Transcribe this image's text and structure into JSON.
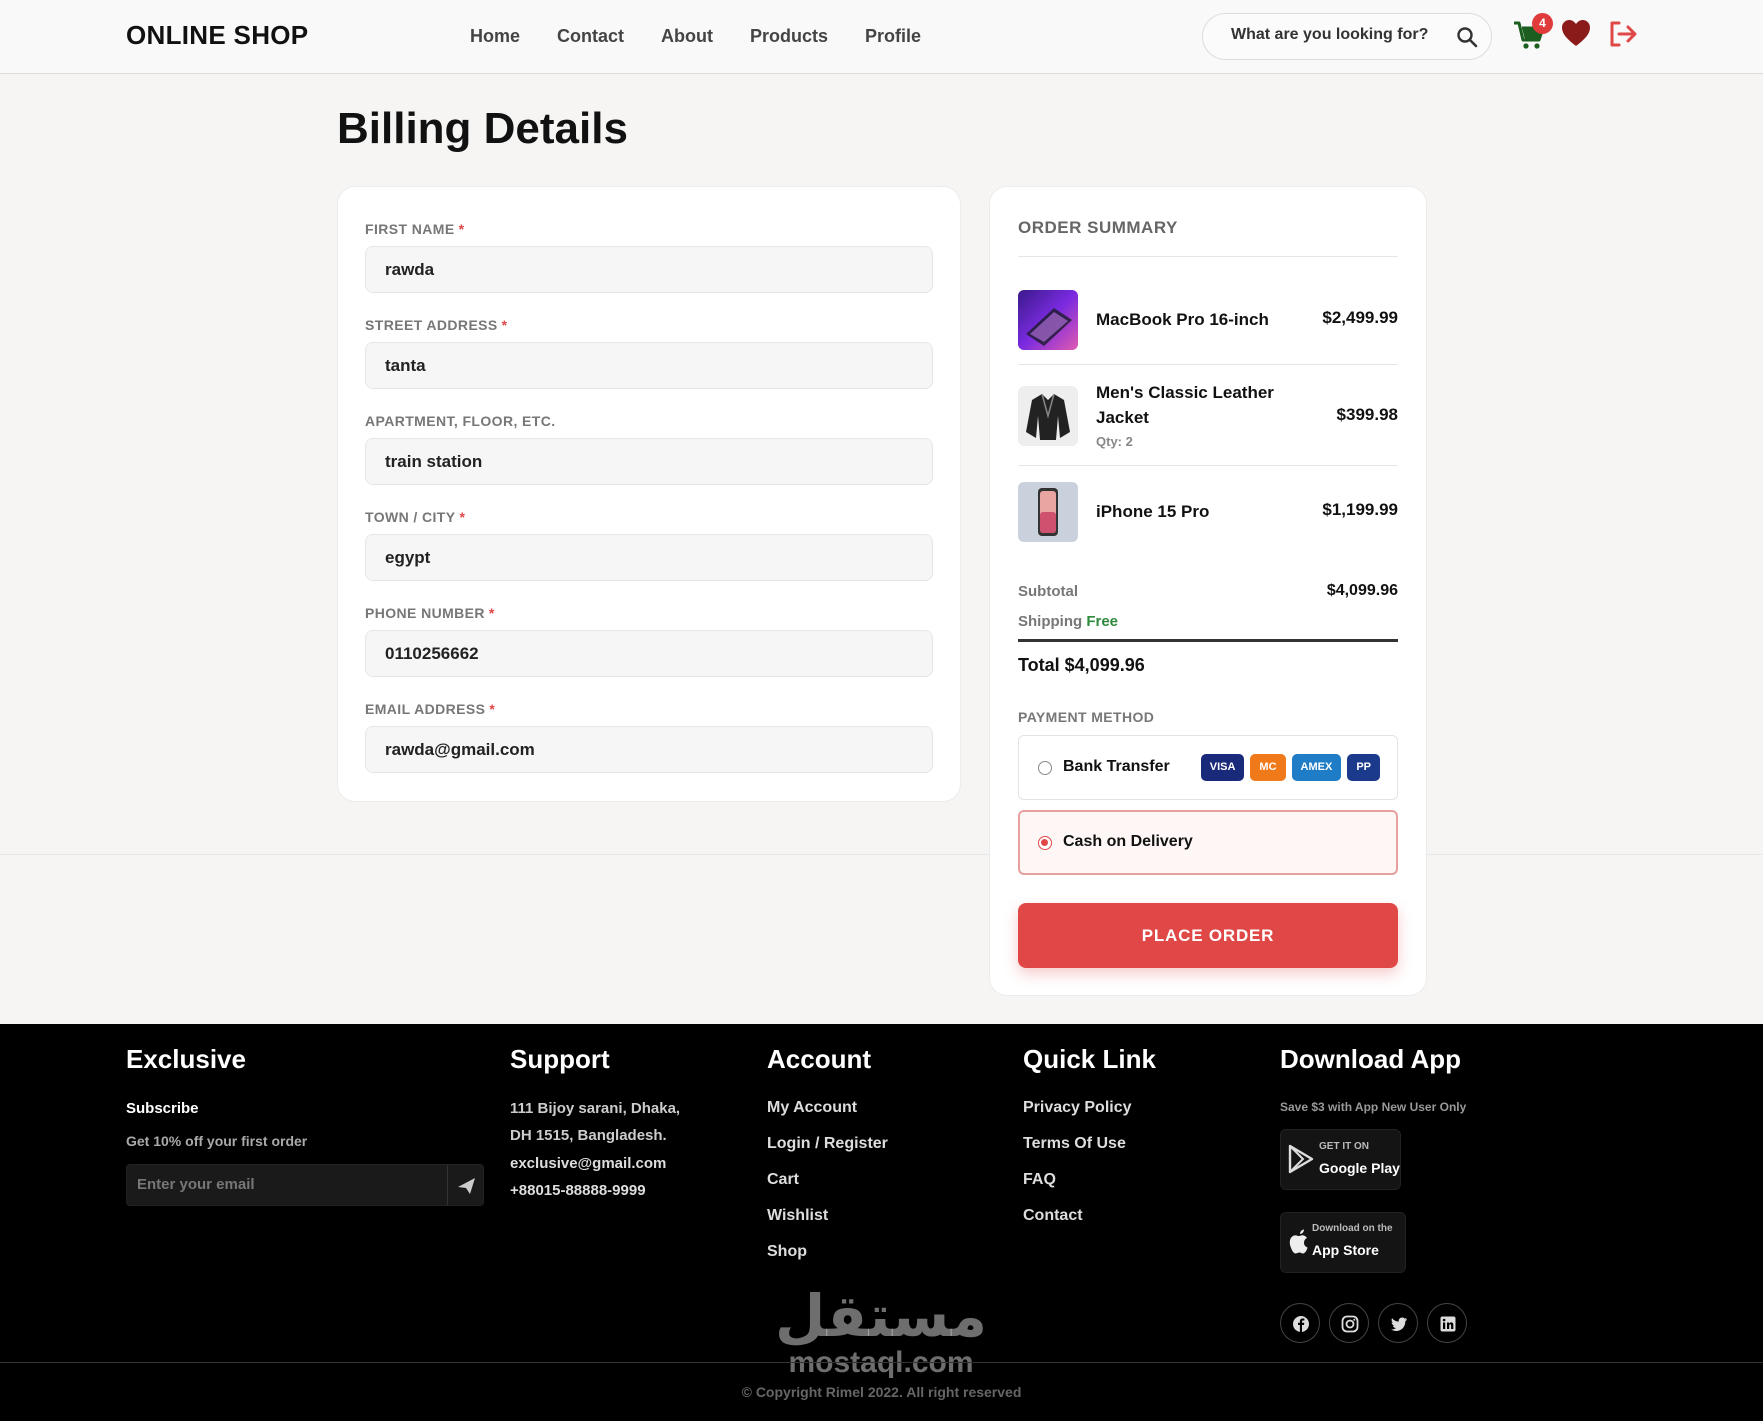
{
  "navbar": {
    "brand": "ONLINE SHOP",
    "links": [
      "Home",
      "Contact",
      "About",
      "Products",
      "Profile"
    ],
    "search_placeholder": "What are you looking for?",
    "cart_count": "4"
  },
  "page": {
    "title": "Billing Details"
  },
  "form": {
    "fields": [
      {
        "label": "FIRST NAME",
        "required": true,
        "value": "rawda"
      },
      {
        "label": "STREET ADDRESS",
        "required": true,
        "value": "tanta"
      },
      {
        "label": "APARTMENT, FLOOR, ETC.",
        "required": false,
        "value": "train station"
      },
      {
        "label": "TOWN / CITY",
        "required": true,
        "value": "egypt"
      },
      {
        "label": "PHONE NUMBER",
        "required": true,
        "value": "0110256662"
      },
      {
        "label": "EMAIL ADDRESS",
        "required": true,
        "value": "rawda@gmail.com"
      }
    ],
    "required_mark": "*"
  },
  "summary": {
    "title": "ORDER SUMMARY",
    "items": [
      {
        "name": "MacBook Pro 16-inch",
        "price": "$2,499.99",
        "qty": ""
      },
      {
        "name": "Men's Classic Leather Jacket",
        "price": "$399.98",
        "qty": "Qty: 2"
      },
      {
        "name": "iPhone 15 Pro",
        "price": "$1,199.99",
        "qty": ""
      }
    ],
    "subtotal_label": "Subtotal",
    "subtotal_value": "$4,099.96",
    "shipping_label": "Shipping",
    "shipping_value": "Free",
    "total_text": "Total $4,099.96",
    "payment_label": "PAYMENT METHOD",
    "payment_options": [
      {
        "label": "Bank Transfer",
        "selected": false
      },
      {
        "label": "Cash on Delivery",
        "selected": true
      }
    ],
    "card_badges": [
      {
        "label": "VISA",
        "color": "#1a2a7a"
      },
      {
        "label": "MC",
        "color": "#f07a1a"
      },
      {
        "label": "AMEX",
        "color": "#1f7cc7"
      },
      {
        "label": "PP",
        "color": "#1b3a8c"
      }
    ],
    "place_order": "PLACE ORDER"
  },
  "footer": {
    "exclusive": {
      "title": "Exclusive",
      "subscribe": "Subscribe",
      "offer": "Get 10% off your first order",
      "email_placeholder": "Enter your email"
    },
    "support": {
      "title": "Support",
      "address_line1": "111 Bijoy sarani, Dhaka,",
      "address_line2": "DH 1515, Bangladesh.",
      "email": "exclusive@gmail.com",
      "phone": "+88015-88888-9999"
    },
    "account": {
      "title": "Account",
      "links": [
        "My Account",
        "Login / Register",
        "Cart",
        "Wishlist",
        "Shop"
      ]
    },
    "quick_link": {
      "title": "Quick Link",
      "links": [
        "Privacy Policy",
        "Terms Of Use",
        "FAQ",
        "Contact"
      ]
    },
    "download": {
      "title": "Download App",
      "note": "Save $3 with App New User Only",
      "google_small": "GET IT ON",
      "google_big": "Google Play",
      "apple_small": "Download on the",
      "apple_big": "App Store"
    },
    "watermark_arabic": "مستقل",
    "watermark_latin": "mostaql.com",
    "copyright": "© Copyright Rimel 2022. All right reserved"
  },
  "colors": {
    "accent": "#e04848",
    "free": "#2e8b3e",
    "heart": "#8b1a1a"
  }
}
